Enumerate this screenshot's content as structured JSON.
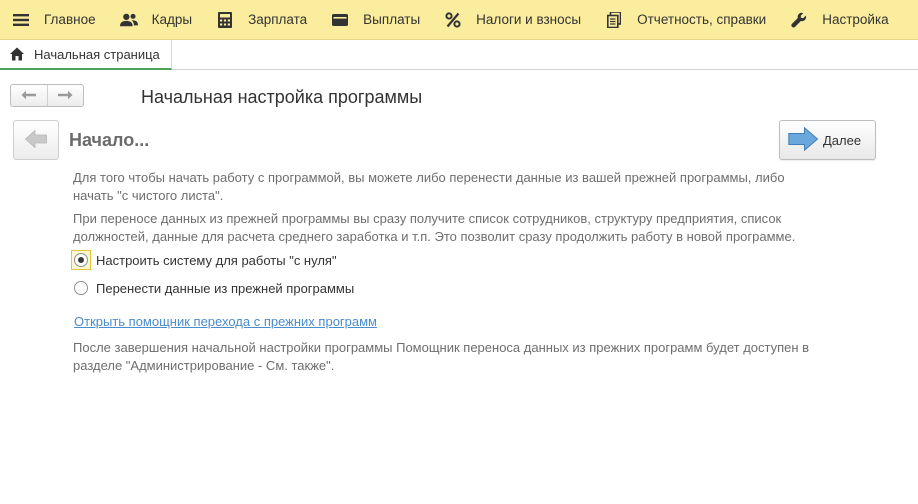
{
  "menu": {
    "items": [
      {
        "label": "Главное",
        "icon": "hamburger-icon"
      },
      {
        "label": "Кадры",
        "icon": "users-icon"
      },
      {
        "label": "Зарплата",
        "icon": "calculator-icon"
      },
      {
        "label": "Выплаты",
        "icon": "wallet-icon"
      },
      {
        "label": "Налоги и взносы",
        "icon": "percent-icon"
      },
      {
        "label": "Отчетность, справки",
        "icon": "documents-icon"
      },
      {
        "label": "Настройка",
        "icon": "wrench-icon"
      }
    ],
    "background": "#fbed9e"
  },
  "tabs": {
    "home_label": "Начальная страница",
    "active_color": "#4da35a"
  },
  "form": {
    "title": "Начальная настройка программы",
    "step_title": "Начало...",
    "next_label": "Далее",
    "intro_text": "Для того чтобы начать работу с программой, вы можете либо перенести данные из вашей прежней программы, либо начать \"с чистого листа\".",
    "transfer_text": "При переносе данных из прежней программы вы сразу получите список сотрудников, структуру предприятия, список должностей, данные для расчета среднего заработка и т.п. Это позволит сразу продолжить работу в новой программе.",
    "options": [
      {
        "label": "Настроить систему для работы \"с нуля\"",
        "selected": true
      },
      {
        "label": "Перенести данные из прежней программы",
        "selected": false
      }
    ],
    "link_text": "Открыть помощник перехода с прежних программ",
    "footer_text": "После завершения начальной настройки программы Помощник переноса данных из прежних программ будет доступен в разделе \"Администрирование - См. также\".",
    "link_color": "#4a8ccc",
    "arrow_color": "#5b9bd5"
  }
}
